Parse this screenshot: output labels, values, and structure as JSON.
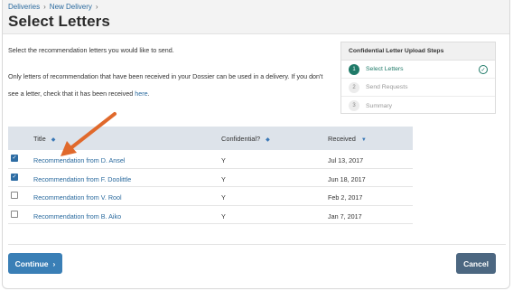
{
  "breadcrumb": {
    "items": [
      "Deliveries",
      "New Delivery"
    ]
  },
  "page": {
    "title": "Select Letters",
    "intro": "Select the recommendation letters you would like to send.",
    "note_prefix": "Only letters of recommendation that have been received in your Dossier can be used in a delivery. If you don't see a letter, check that it has been received ",
    "note_link": "here",
    "note_suffix": "."
  },
  "steps": {
    "title": "Confidential Letter Upload Steps",
    "items": [
      {
        "number": "1",
        "label": "Select Letters",
        "state": "active"
      },
      {
        "number": "2",
        "label": "Send Requests",
        "state": "inactive"
      },
      {
        "number": "3",
        "label": "Summary",
        "state": "inactive"
      }
    ]
  },
  "table": {
    "headers": {
      "title": "Title",
      "confidential": "Confidential?",
      "received": "Received"
    },
    "rows": [
      {
        "checked": true,
        "title": "Recommendation from D. Ansel",
        "confidential": "Y",
        "received": "Jul 13, 2017"
      },
      {
        "checked": true,
        "title": "Recommendation from F. Doolittle",
        "confidential": "Y",
        "received": "Jun 18, 2017"
      },
      {
        "checked": false,
        "title": "Recommendation from V. Rool",
        "confidential": "Y",
        "received": "Feb 2, 2017"
      },
      {
        "checked": false,
        "title": "Recommendation from B. Aiko",
        "confidential": "Y",
        "received": "Jan 7, 2017"
      }
    ]
  },
  "buttons": {
    "continue": "Continue",
    "cancel": "Cancel"
  },
  "colors": {
    "accent": "#3a7fb6",
    "step_active": "#1f7a68",
    "arrow": "#e0692c",
    "cancel": "#4c6781"
  }
}
